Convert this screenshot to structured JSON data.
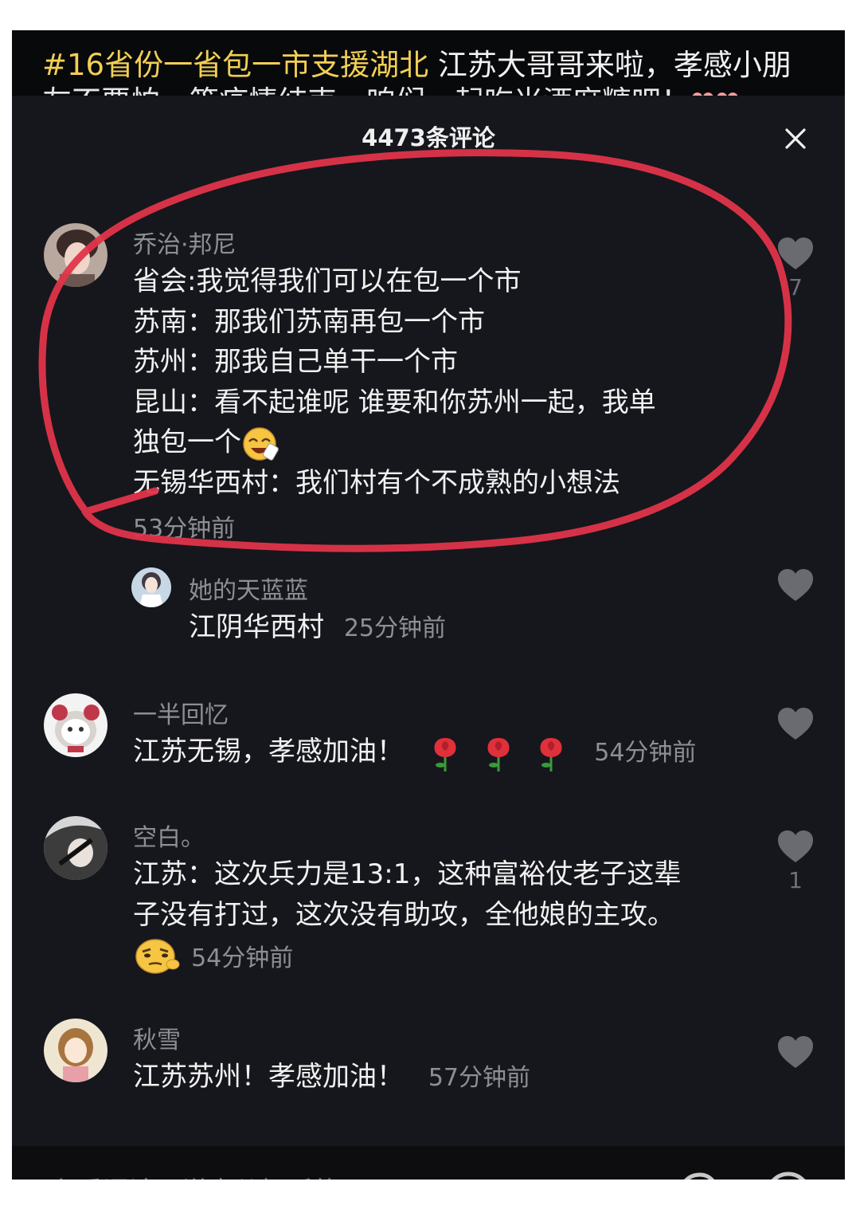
{
  "caption": {
    "tag": "#16省份一省包一市支援湖北",
    "text": " 江苏大哥哥来啦，孝感小朋",
    "cut_line": "友不要怕，等疫情结束，咱们一起吃米酒麻糖吧！",
    "hearts": "❤❤"
  },
  "panel": {
    "title": "4473条评论"
  },
  "comments": [
    {
      "user": "乔治·邦尼",
      "lines": [
        "省会:我觉得我们可以在包一个市",
        "苏南：那我们苏南再包一个市",
        "苏州：那我自己单干一个市",
        "昆山：看不起谁呢 谁要和你苏州一起，我单",
        "独包一个"
      ],
      "last_line": "无锡华西村：我们村有个不成熟的小想法",
      "time": "53分钟前",
      "likes": "7"
    },
    {
      "user": "她的天蓝蓝",
      "text": "江阴华西村",
      "time": "25分钟前"
    },
    {
      "user": "一半回忆",
      "text": "江苏无锡，孝感加油！",
      "time": "54分钟前"
    },
    {
      "user": "空白。",
      "lines": [
        "江苏：这次兵力是13:1，这种富裕仗老子这辈",
        "子没有打过，这次没有助攻，全他娘的主攻。"
      ],
      "time": "54分钟前",
      "likes": "1"
    },
    {
      "user": "秋雪",
      "text": "江苏苏州！孝感加油！",
      "time": "57分钟前"
    }
  ],
  "input": {
    "placeholder": "有爱评论，说点儿好听的~"
  },
  "colors": {
    "background": "#16171c",
    "username": "#8e8f94",
    "tag": "#f3cf55",
    "annotation": "#e0344a"
  }
}
